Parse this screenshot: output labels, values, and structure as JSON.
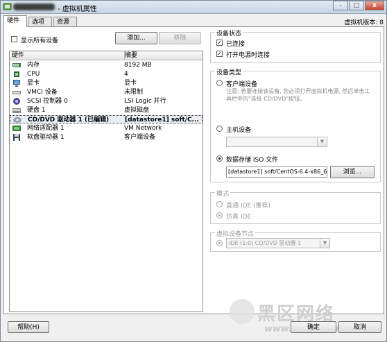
{
  "window": {
    "title": "- 虚拟机属性",
    "version_label": "虚拟机版本: 8",
    "controls": {
      "minimize": "-",
      "restore": "□",
      "close": "x"
    }
  },
  "tabs": [
    {
      "label": "硬件",
      "active": true
    },
    {
      "label": "选项",
      "active": false
    },
    {
      "label": "资源",
      "active": false
    }
  ],
  "hardware": {
    "show_all_label": "显示所有设备",
    "show_all_checked": false,
    "add_button": "添加...",
    "remove_button": "移除",
    "columns": {
      "hardware": "硬件",
      "summary": "摘要"
    },
    "rows": [
      {
        "icon": "memory-icon",
        "name": "内存",
        "summary": "8192 MB"
      },
      {
        "icon": "cpu-icon",
        "name": "CPU",
        "summary": "4"
      },
      {
        "icon": "video-card-icon",
        "name": "显卡",
        "summary": "显卡"
      },
      {
        "icon": "vmci-icon",
        "name": "VMCI 设备",
        "summary": "未限制"
      },
      {
        "icon": "scsi-icon",
        "name": "SCSI 控制器 0",
        "summary": "LSI Logic 并行"
      },
      {
        "icon": "harddisk-icon",
        "name": "硬盘 1",
        "summary": "虚拟磁盘"
      },
      {
        "icon": "cd-dvd-icon",
        "name": "CD/DVD 驱动器 1 (已编辑)",
        "summary": "[datastore1] soft/C...",
        "selected": true
      },
      {
        "icon": "network-adapter-icon",
        "name": "网络适配器 1",
        "summary": "VM Network"
      },
      {
        "icon": "floppy-icon",
        "name": "软盘驱动器 1",
        "summary": "客户端设备"
      }
    ]
  },
  "device_status": {
    "title": "设备状态",
    "connected": {
      "label": "已连接",
      "checked": true
    },
    "connect_at_power_on": {
      "label": "打开电源时连接",
      "checked": true
    }
  },
  "device_type": {
    "title": "设备类型",
    "client_device": {
      "label": "客户端设备",
      "hint": "注意: 若要连接该设备, 您必须打开虚拟机电源, 然后单击工具栏中的\"连接 CD/DVD\"按钮。"
    },
    "host_device": {
      "label": "主机设备",
      "value": ""
    },
    "datastore_iso": {
      "label": "数据存储 ISO 文件",
      "selected": true,
      "path": "[datastore1] soft/CentOS-6.4-x86_6",
      "browse_button": "浏览..."
    }
  },
  "mode": {
    "title": "模式",
    "passthrough": "直通 IDE (推荐)",
    "emulate": "仿真 IDE",
    "emulate_selected": true
  },
  "virtual_node": {
    "title": "虚拟设备节点",
    "value": "IDE (1:0) CD/DVD 驱动器 1"
  },
  "footer": {
    "help_button": "帮助(H)",
    "ok_button": "确定",
    "cancel_button": "取消"
  },
  "watermark": {
    "text": "黑区网络",
    "url": "www.heiqu.com"
  }
}
